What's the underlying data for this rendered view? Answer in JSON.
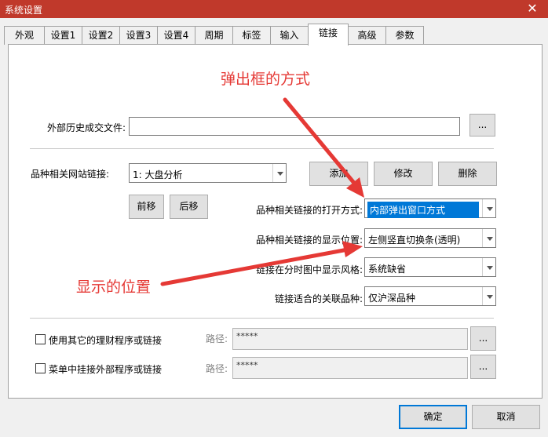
{
  "window": {
    "title": "系统设置",
    "close_label": "✕"
  },
  "tabs": [
    "外观",
    "设置1",
    "设置2",
    "设置3",
    "设置4",
    "周期",
    "标签",
    "输入",
    "链接",
    "高级",
    "参数"
  ],
  "active_tab": "链接",
  "external_file": {
    "label": "外部历史成交文件:",
    "value": "",
    "browse_label": "..."
  },
  "site_link": {
    "label": "品种相关网站链接:",
    "selected": "1: 大盘分析",
    "add_label": "添加",
    "modify_label": "修改",
    "delete_label": "删除",
    "move_up_label": "前移",
    "move_down_label": "后移"
  },
  "open_mode": {
    "label": "品种相关链接的打开方式:",
    "value": "内部弹出窗口方式"
  },
  "display_pos": {
    "label": "品种相关链接的显示位置:",
    "value": "左侧竖直切换条(透明)"
  },
  "style": {
    "label": "链接在分时图中显示风格:",
    "value": "系统缺省"
  },
  "scope": {
    "label": "链接适合的关联品种:",
    "value": "仅沪深品种"
  },
  "other_program": {
    "label": "使用其它的理财程序或链接",
    "path_label": "路径:",
    "path_value": "*****",
    "browse_label": "..."
  },
  "menu_program": {
    "label": "菜单中挂接外部程序或链接",
    "path_label": "路径:",
    "path_value": "*****",
    "browse_label": "..."
  },
  "footer": {
    "ok_label": "确定",
    "cancel_label": "取消"
  },
  "annotations": {
    "popup_mode": "弹出框的方式",
    "display_position": "显示的位置"
  },
  "colors": {
    "titlebar": "#c0392b",
    "annotation": "#e53935",
    "selection": "#0078d7"
  }
}
